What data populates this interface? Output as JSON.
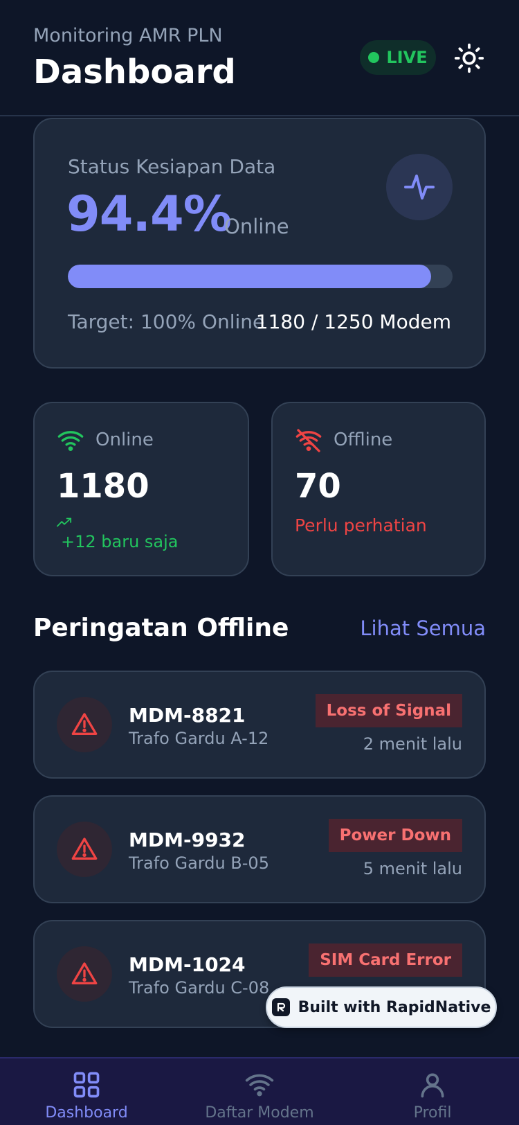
{
  "header": {
    "subtitle": "Monitoring AMR PLN",
    "title": "Dashboard",
    "live_label": "LIVE",
    "toggle_icon": "sun-icon"
  },
  "readiness": {
    "label": "Status Kesiapan Data",
    "value": "94.4%",
    "unit": "Online",
    "progress_percent": 94.4,
    "target": "Target: 100% Online",
    "count": "1180 / 1250 Modem",
    "icon": "activity-icon"
  },
  "stats": {
    "online": {
      "label": "Online",
      "value": "1180",
      "trend": "+12 baru saja",
      "icon": "wifi-icon"
    },
    "offline": {
      "label": "Offline",
      "value": "70",
      "note": "Perlu perhatian",
      "icon": "wifi-off-icon"
    }
  },
  "alerts_section": {
    "title": "Peringatan Offline",
    "see_all": "Lihat Semua",
    "items": [
      {
        "id": "MDM-8821",
        "location": "Trafo Gardu A-12",
        "tag": "Loss of Signal",
        "time": "2 menit lalu"
      },
      {
        "id": "MDM-9932",
        "location": "Trafo Gardu B-05",
        "tag": "Power Down",
        "time": "5 menit lalu"
      },
      {
        "id": "MDM-1024",
        "location": "Trafo Gardu C-08",
        "tag": "SIM Card Error",
        "time": ""
      }
    ]
  },
  "badge": {
    "text": "Built with RapidNative"
  },
  "nav": {
    "items": [
      {
        "label": "Dashboard",
        "icon": "grid-icon",
        "active": true
      },
      {
        "label": "Daftar Modem",
        "icon": "wifi-icon",
        "active": false
      },
      {
        "label": "Profil",
        "icon": "user-icon",
        "active": false
      }
    ]
  },
  "colors": {
    "background": "#0e1628",
    "card": "#1e293b",
    "accent": "#818cf8",
    "online": "#22c55e",
    "offline": "#ef4444"
  }
}
